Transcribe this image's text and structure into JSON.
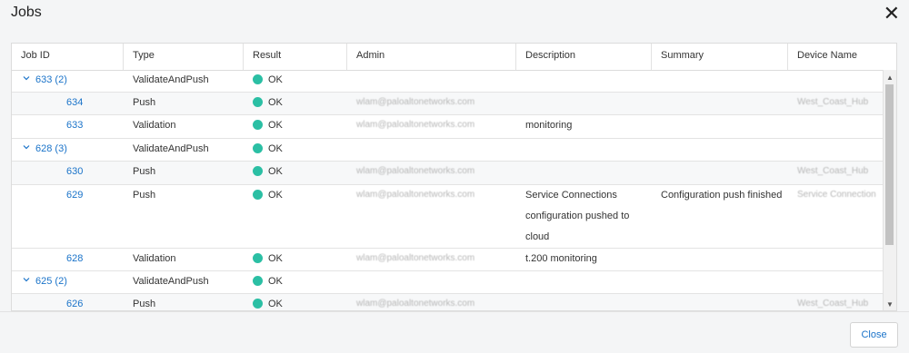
{
  "dialog": {
    "title": "Jobs",
    "close_label": "Close"
  },
  "columns": [
    "Job ID",
    "Type",
    "Result",
    "Admin",
    "Description",
    "Summary",
    "Device Name"
  ],
  "rows": [
    {
      "job_id": "633 (2)",
      "type": "ValidateAndPush",
      "result": "OK",
      "admin": "",
      "description": "",
      "summary": "",
      "device": "",
      "group": true
    },
    {
      "job_id": "634",
      "type": "Push",
      "result": "OK",
      "admin": "wlam@paloaltonetworks.com",
      "description": "",
      "summary": "",
      "device": "West_Coast_Hub",
      "group": false
    },
    {
      "job_id": "633",
      "type": "Validation",
      "result": "OK",
      "admin": "wlam@paloaltonetworks.com",
      "description": "monitoring",
      "summary": "",
      "device": "",
      "group": false
    },
    {
      "job_id": "628 (3)",
      "type": "ValidateAndPush",
      "result": "OK",
      "admin": "",
      "description": "",
      "summary": "",
      "device": "",
      "group": true
    },
    {
      "job_id": "630",
      "type": "Push",
      "result": "OK",
      "admin": "wlam@paloaltonetworks.com",
      "description": "",
      "summary": "",
      "device": "West_Coast_Hub",
      "group": false
    },
    {
      "job_id": "629",
      "type": "Push",
      "result": "OK",
      "admin": "wlam@paloaltonetworks.com",
      "description": "Service Connections configuration pushed to cloud",
      "summary": "Configuration push finished",
      "device": "Service Connection",
      "group": false
    },
    {
      "job_id": "628",
      "type": "Validation",
      "result": "OK",
      "admin": "wlam@paloaltonetworks.com",
      "description": "t.200 monitoring",
      "summary": "",
      "device": "",
      "group": false
    },
    {
      "job_id": "625 (2)",
      "type": "ValidateAndPush",
      "result": "OK",
      "admin": "",
      "description": "",
      "summary": "",
      "device": "",
      "group": true
    },
    {
      "job_id": "626",
      "type": "Push",
      "result": "OK",
      "admin": "wlam@paloaltonetworks.com",
      "description": "",
      "summary": "",
      "device": "West_Coast_Hub",
      "group": false
    }
  ],
  "colors": {
    "accent": "#1a73c9",
    "ok": "#2bbfa4"
  }
}
